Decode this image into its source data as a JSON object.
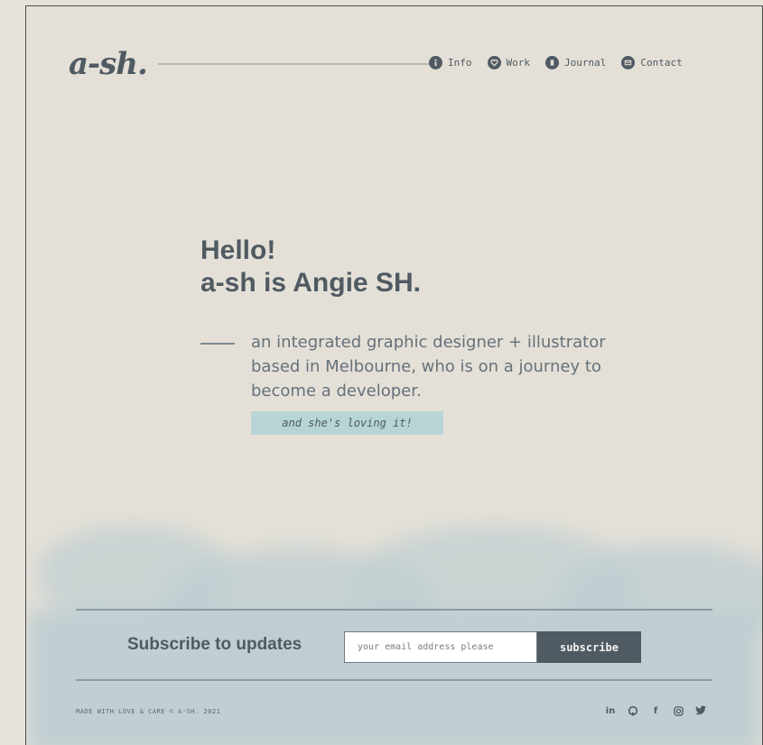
{
  "brand": {
    "logo": "a-sh."
  },
  "nav": {
    "items": [
      {
        "label": "Info",
        "icon": "info-icon"
      },
      {
        "label": "Work",
        "icon": "heart-icon"
      },
      {
        "label": "Journal",
        "icon": "journal-icon"
      },
      {
        "label": "Contact",
        "icon": "mail-icon"
      }
    ]
  },
  "hero": {
    "greeting": "Hello!",
    "name_line": "a-sh is Angie SH.",
    "description": "an integrated graphic designer + illustrator based in Melbourne, who is on a journey to become a developer.",
    "tagline": "and she's loving it!"
  },
  "subscribe": {
    "label": "Subscribe to updates",
    "placeholder": "your email address please",
    "button": "subscribe"
  },
  "footer": {
    "note": "MADE WITH LOVE & CARE © A-SH. 2021",
    "social": [
      {
        "label": "in",
        "icon": "linkedin-icon"
      },
      {
        "label": "",
        "icon": "github-icon"
      },
      {
        "label": "f",
        "icon": "facebook-icon"
      },
      {
        "label": "",
        "icon": "instagram-icon"
      },
      {
        "label": "",
        "icon": "twitter-icon"
      }
    ]
  },
  "colors": {
    "background": "#e4e0d7",
    "text": "#4f5a62",
    "accent_tag": "#b8d5d6",
    "clouds": "#bfced2"
  }
}
